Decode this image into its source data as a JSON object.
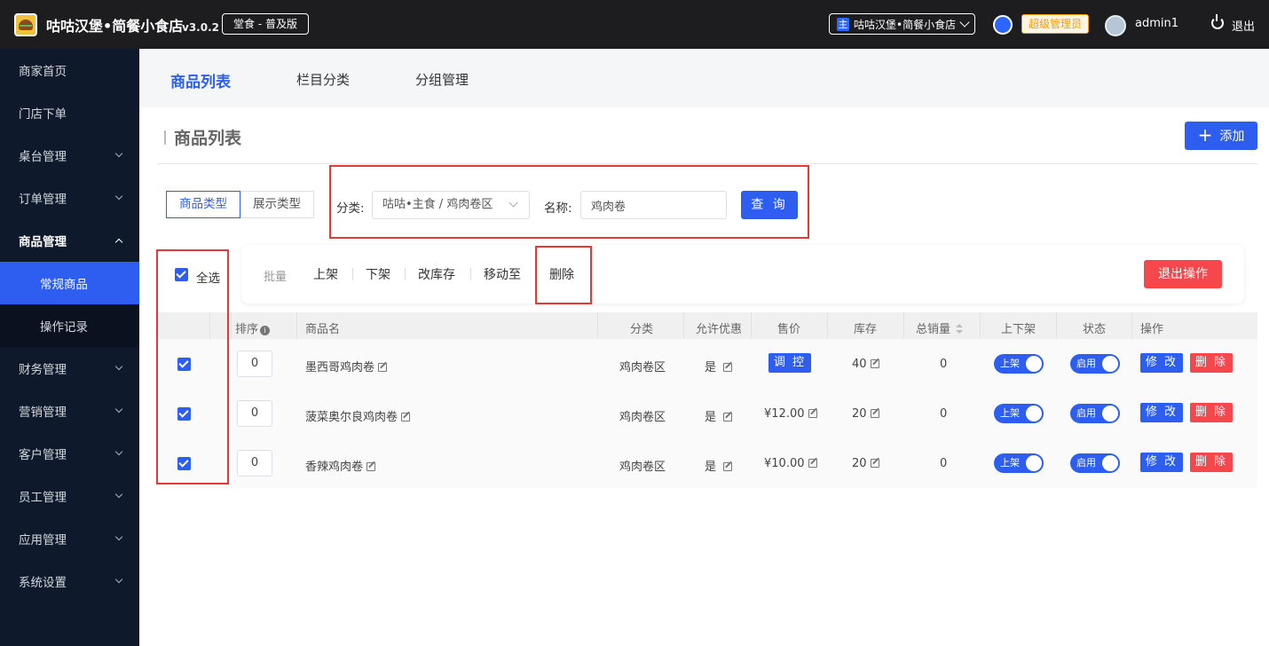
{
  "header": {
    "app_title": "咕咕汉堡•简餐小食店",
    "version": "v3.0.2",
    "edition": "堂食 - 普及版",
    "store_tag": "主",
    "store_name": "咕咕汉堡•简餐小食店",
    "role_badge": "超级管理员",
    "username": "admin1",
    "logout": "退出"
  },
  "sidebar": {
    "items": [
      {
        "label": "商家首页"
      },
      {
        "label": "门店下单"
      },
      {
        "label": "桌台管理"
      },
      {
        "label": "订单管理"
      },
      {
        "label": "商品管理"
      },
      {
        "label": "常规商品"
      },
      {
        "label": "操作记录"
      },
      {
        "label": "财务管理"
      },
      {
        "label": "营销管理"
      },
      {
        "label": "客户管理"
      },
      {
        "label": "员工管理"
      },
      {
        "label": "应用管理"
      },
      {
        "label": "系统设置"
      }
    ]
  },
  "tabs": [
    "商品列表",
    "栏目分类",
    "分组管理"
  ],
  "section": {
    "title": "商品列表",
    "add_button": "添加"
  },
  "filters": {
    "type_tabs": [
      "商品类型",
      "展示类型"
    ],
    "category_label": "分类:",
    "category_value": "咕咕•主食 / 鸡肉卷区",
    "name_label": "名称:",
    "name_value": "鸡肉卷",
    "query_button": "查 询"
  },
  "batch": {
    "select_all": "全选",
    "label": "批量",
    "actions": [
      "上架",
      "下架",
      "改库存",
      "移动至",
      "删除"
    ],
    "exit_button": "退出操作"
  },
  "table": {
    "headers": [
      "排序",
      "商品名",
      "分类",
      "允许优惠",
      "售价",
      "库存",
      "总销量",
      "上下架",
      "状态",
      "操作"
    ],
    "rows": [
      {
        "sort": "0",
        "name": "墨西哥鸡肉卷",
        "category": "鸡肉卷区",
        "discount": "是",
        "price": "调 控",
        "price_is_button": true,
        "stock": "40",
        "sales": "0",
        "shelf": "上架",
        "status": "启用",
        "edit": "修 改",
        "delete": "删 除"
      },
      {
        "sort": "0",
        "name": "菠菜奥尔良鸡肉卷",
        "category": "鸡肉卷区",
        "discount": "是",
        "price": "¥12.00",
        "price_is_button": false,
        "stock": "20",
        "sales": "0",
        "shelf": "上架",
        "status": "启用",
        "edit": "修 改",
        "delete": "删 除"
      },
      {
        "sort": "0",
        "name": "香辣鸡肉卷",
        "category": "鸡肉卷区",
        "discount": "是",
        "price": "¥10.00",
        "price_is_button": false,
        "stock": "20",
        "sales": "0",
        "shelf": "上架",
        "status": "启用",
        "edit": "修 改",
        "delete": "删 除"
      }
    ]
  },
  "colors": {
    "primary": "#2d5ef0",
    "danger": "#f5474c",
    "sidebar_bg": "#0e1a2b",
    "topbar_bg": "#1d1d1f",
    "highlight_box": "#e53935"
  }
}
